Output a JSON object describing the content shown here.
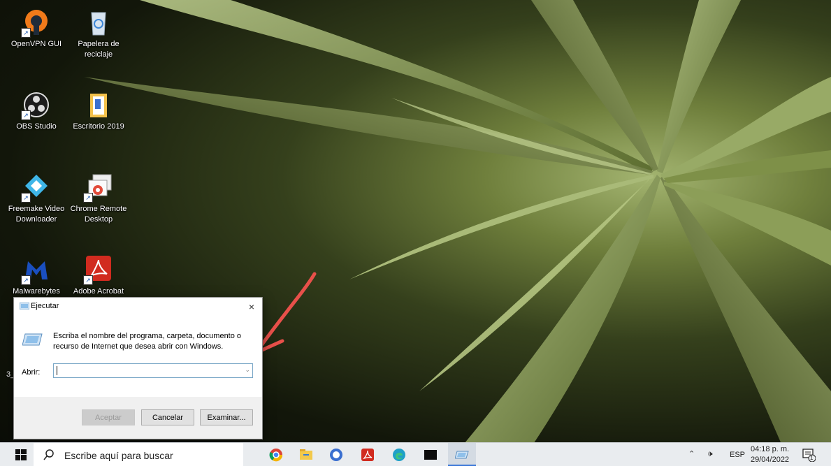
{
  "desktop": {
    "icons": [
      {
        "label": "OpenVPN GUI",
        "icon": "openvpn-icon"
      },
      {
        "label": "Papelera de reciclaje",
        "icon": "recycle-bin-icon"
      },
      {
        "label": "OBS Studio",
        "icon": "obs-icon"
      },
      {
        "label": "Escritorio 2019",
        "icon": "folder-icon"
      },
      {
        "label": "Freemake Video Downloader",
        "icon": "freemake-icon"
      },
      {
        "label": "Chrome Remote Desktop",
        "icon": "chrome-remote-desktop-icon"
      },
      {
        "label": "Malwarebytes",
        "icon": "malwarebytes-icon"
      },
      {
        "label": "Adobe Acrobat",
        "icon": "acrobat-icon"
      }
    ],
    "stray_text": "3_"
  },
  "run_dialog": {
    "title": "Ejecutar",
    "close": "×",
    "description": "Escriba el nombre del programa, carpeta, documento o recurso de Internet que desea abrir con Windows.",
    "open_label": "Abrir:",
    "open_value": "",
    "buttons": {
      "ok": "Aceptar",
      "cancel": "Cancelar",
      "browse": "Examinar..."
    }
  },
  "annotation": {
    "color": "#e8504a"
  },
  "taskbar": {
    "search_placeholder": "Escribe aquí para buscar",
    "apps": [
      "chrome-icon",
      "file-explorer-icon",
      "obs-icon",
      "acrobat-icon",
      "edge-icon",
      "terminal-icon",
      "run-icon"
    ],
    "tray": {
      "language": "ESP",
      "time": "04:18 p. m.",
      "date": "29/04/2022",
      "notification_count": "1"
    }
  }
}
